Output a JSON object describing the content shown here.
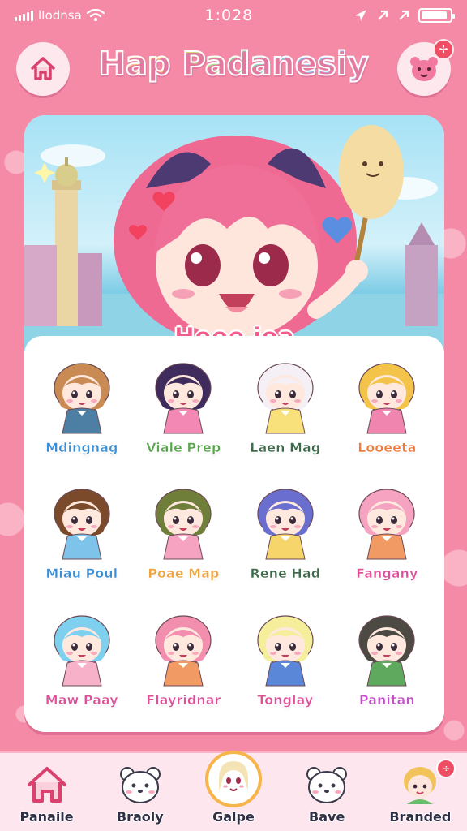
{
  "status": {
    "carrier": "lIodnsa",
    "time": "1:028",
    "battery_level": 0.9
  },
  "header": {
    "title": "Hap Padanesiy",
    "home_icon": "home-icon",
    "bear_icon": "bear-face-icon",
    "notification_badge": "✢"
  },
  "hero": {
    "title": "Hooe ioa"
  },
  "characters": [
    {
      "name": "Mdingnag",
      "hair": "#c98a54",
      "outfit": "#4c7fa3",
      "color": "#3a8fd8"
    },
    {
      "name": "Viale Prep",
      "hair": "#3f2b5c",
      "outfit": "#f288b3",
      "color": "#5aa44f"
    },
    {
      "name": "Laen Mag",
      "hair": "#f4f0f5",
      "outfit": "#f8e07a",
      "color": "#3c6a4a"
    },
    {
      "name": "Looeeta",
      "hair": "#f3c34a",
      "outfit": "#f086b0",
      "color": "#f07a3c"
    },
    {
      "name": "Miau Poul",
      "hair": "#7a4a2a",
      "outfit": "#7ec3ea",
      "color": "#3a8fd8"
    },
    {
      "name": "Poae Map",
      "hair": "#6f7f3a",
      "outfit": "#f6a3c2",
      "color": "#f0a23c"
    },
    {
      "name": "Rene Had",
      "hair": "#6a6fcf",
      "outfit": "#f6d66b",
      "color": "#3c6a4a"
    },
    {
      "name": "Fangany",
      "hair": "#f5a3c0",
      "outfit": "#f29a63",
      "color": "#e0509a"
    },
    {
      "name": "Maw Paay",
      "hair": "#7fd0ef",
      "outfit": "#f7b1c9",
      "color": "#e0509a"
    },
    {
      "name": "Flayridnar",
      "hair": "#f28fae",
      "outfit": "#f29a63",
      "color": "#e0509a"
    },
    {
      "name": "Tonglay",
      "hair": "#f5ef9c",
      "outfit": "#5b87d8",
      "color": "#e0509a"
    },
    {
      "name": "Panitan",
      "hair": "#4c4a42",
      "outfit": "#5fa95e",
      "color": "#c54fc9"
    }
  ],
  "nav": [
    {
      "label": "Panaile",
      "icon": "house-icon"
    },
    {
      "label": "Braoly",
      "icon": "bear-icon"
    },
    {
      "label": "Galpe",
      "icon": "character-face-icon",
      "active": true
    },
    {
      "label": "Bave",
      "icon": "bear-icon"
    },
    {
      "label": "Branded",
      "icon": "avatar-icon",
      "badge": "÷"
    }
  ]
}
